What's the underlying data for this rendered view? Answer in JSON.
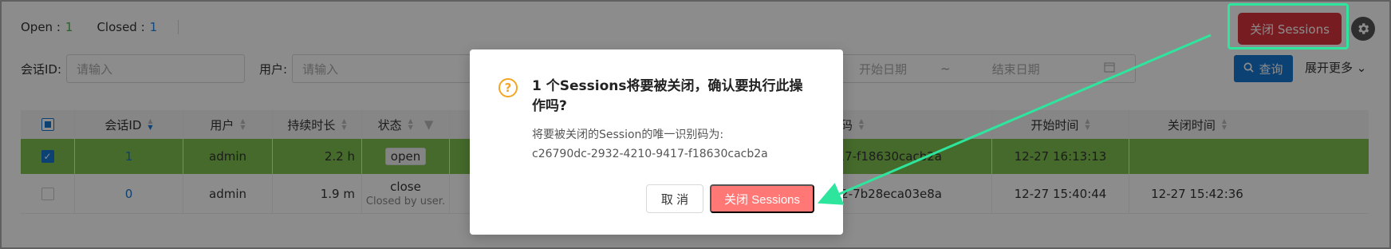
{
  "topbar": {
    "open_label": "Open :",
    "open_count": "1",
    "closed_label": "Closed :",
    "closed_count": "1"
  },
  "actions": {
    "close_sessions_label": "关闭 Sessions",
    "gear_icon": "gear-icon"
  },
  "filters": {
    "session_id_label": "会话ID:",
    "session_id_placeholder": "请输入",
    "user_label": "用户:",
    "user_placeholder": "请输入",
    "start_date_placeholder": "开始日期",
    "range_sep": "~",
    "end_date_placeholder": "结束日期",
    "query_label": "查询",
    "expand_label": "展开更多"
  },
  "table": {
    "headers": [
      "会话ID",
      "用户",
      "持续时长",
      "状态",
      "唯一识别码",
      "开始时间",
      "关闭时间"
    ],
    "rows": [
      {
        "id": "1",
        "user": "admin",
        "duration": "2.2 h",
        "status": "open",
        "status_sub": "",
        "uid": "c26790dc-2932-4210-9417-f18630cacb2a",
        "uid_visible": "90dc-2932-4210-9417-f18630cacb2a",
        "start": "12-27 16:13:13",
        "end": ""
      },
      {
        "id": "0",
        "user": "admin",
        "duration": "1.9 m",
        "status": "close",
        "status_sub": "Closed by user.",
        "uid_visible": "263-9683-42b3-a962-7b28eca03e8a",
        "start": "12-27 15:40:44",
        "end": "12-27 15:42:36"
      }
    ]
  },
  "modal": {
    "title": "1 个Sessions将要被关闭，确认要执行此操作吗?",
    "content_line1": "将要被关闭的Session的唯一识别码为:",
    "content_line2": "c26790dc-2932-4210-9417-f18630cacb2a",
    "cancel_label": "取 消",
    "ok_label": "关闭 Sessions"
  },
  "colors": {
    "accent": "#1677d2",
    "danger": "#d9363e",
    "highlight": "#2ee59d",
    "row_selected": "#7ec24f"
  }
}
